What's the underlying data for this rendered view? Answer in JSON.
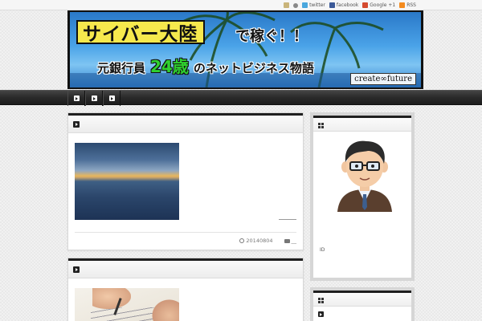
{
  "social": [
    {
      "icon": "smiley-icon",
      "label": ""
    },
    {
      "icon": "user-icon",
      "label": ""
    },
    {
      "icon": "twitter-icon",
      "label": "twitter"
    },
    {
      "icon": "facebook-icon",
      "label": "facebook"
    },
    {
      "icon": "google-plus-icon",
      "label": "Google +1"
    },
    {
      "icon": "rss-icon",
      "label": "RSS"
    }
  ],
  "banner": {
    "title": "サイバー大陸",
    "title_suffix": "で稼ぐ！！",
    "subtitle_pre": "元銀行員",
    "subtitle_age": "24歳",
    "subtitle_post": "のネットビジネス物語",
    "tagline": "create∞future"
  },
  "nav": {
    "item_count": 3
  },
  "posts": [
    {
      "date": "20140804",
      "category": "__",
      "thumbnail": "ocean sunset"
    },
    {
      "thumbnail": "handwriting"
    }
  ],
  "sidebar": {
    "profile_caption": "ID",
    "colors": {
      "accent": "#1f1f1f",
      "widget_frame": "#d6d6d6"
    }
  }
}
